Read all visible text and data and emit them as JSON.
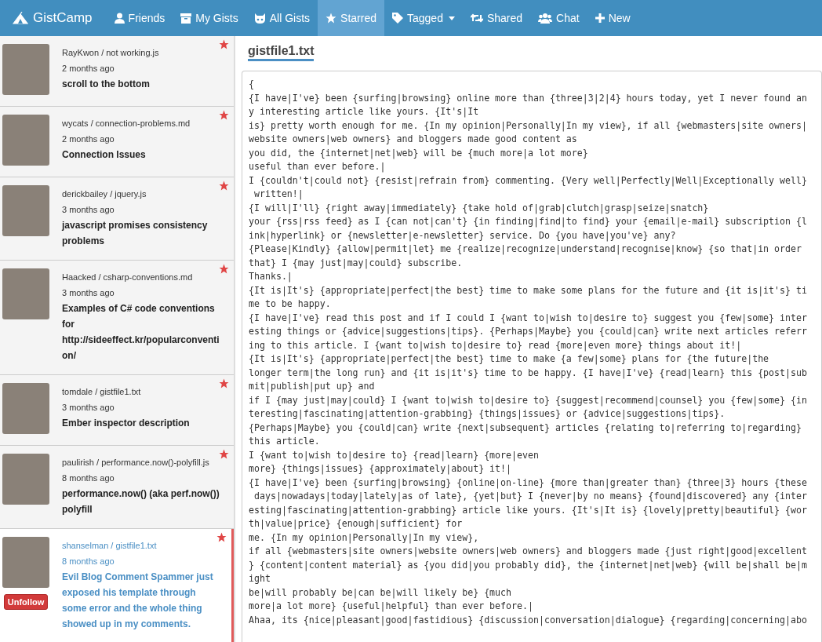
{
  "navbar": {
    "brand": "GistCamp",
    "items": [
      {
        "label": "Friends",
        "kind": "user",
        "selected": false,
        "dropdown": false
      },
      {
        "label": "My Gists",
        "kind": "box",
        "selected": false,
        "dropdown": false
      },
      {
        "label": "All Gists",
        "kind": "cat",
        "selected": false,
        "dropdown": false
      },
      {
        "label": "Starred",
        "kind": "star",
        "selected": true,
        "dropdown": false
      },
      {
        "label": "Tagged",
        "kind": "tag",
        "selected": false,
        "dropdown": true
      },
      {
        "label": "Shared",
        "kind": "retweet",
        "selected": false,
        "dropdown": false
      },
      {
        "label": "Chat",
        "kind": "group",
        "selected": false,
        "dropdown": false
      },
      {
        "label": "New",
        "kind": "plus",
        "selected": false,
        "dropdown": false
      }
    ]
  },
  "gists": [
    {
      "author": "RayKwon / not working.js",
      "time": "2 months ago",
      "title": "scroll to the bottom",
      "selected": false
    },
    {
      "author": "wycats / connection-problems.md",
      "time": "2 months ago",
      "title": "Connection Issues",
      "selected": false
    },
    {
      "author": "derickbailey / jquery.js",
      "time": "3 months ago",
      "title": "javascript promises consistency problems",
      "selected": false
    },
    {
      "author": "Haacked / csharp-conventions.md",
      "time": "3 months ago",
      "title": "Examples of C# code conventions for http://sideeffect.kr/popularconvention/",
      "selected": false
    },
    {
      "author": "tomdale / gistfile1.txt",
      "time": "3 months ago",
      "title": "Ember inspector description",
      "selected": false
    },
    {
      "author": "paulirish / performance.now()-polyfill.js",
      "time": "8 months ago",
      "title": "performance.now() (aka perf.now()) polyfill",
      "selected": false
    },
    {
      "author": "shanselman / gistfile1.txt",
      "time": "8 months ago",
      "title": "Evil Blog Comment Spammer just exposed his template through some error and the whole thing showed up in my comments.",
      "selected": true,
      "button": "Unfollow"
    }
  ],
  "file": {
    "name": "gistfile1.txt",
    "lines": [
      "{",
      "{I have|I've} been {surfing|browsing} online more than {three|3|2|4} hours today, yet I never found an",
      "y interesting article like yours. {It's|It",
      "is} pretty worth enough for me. {In my opinion|Personally|In my view}, if all {webmasters|site owners|",
      "website owners|web owners} and bloggers made good content as",
      "you did, the {internet|net|web} will be {much more|a lot more}",
      "useful than ever before.|",
      "I {couldn't|could not} {resist|refrain from} commenting. {Very well|Perfectly|Well|Exceptionally well}",
      " written!|",
      "{I will|I'll} {right away|immediately} {take hold of|grab|clutch|grasp|seize|snatch}",
      "your {rss|rss feed} as I {can not|can't} {in finding|find|to find} your {email|e-mail} subscription {l",
      "ink|hyperlink} or {newsletter|e-newsletter} service. Do {you have|you've} any?",
      "{Please|Kindly} {allow|permit|let} me {realize|recognize|understand|recognise|know} {so that|in order",
      "that} I {may just|may|could} subscribe.",
      "Thanks.|",
      "{It is|It's} {appropriate|perfect|the best} time to make some plans for the future and {it is|it's} ti",
      "me to be happy.",
      "{I have|I've} read this post and if I could I {want to|wish to|desire to} suggest you {few|some} inter",
      "esting things or {advice|suggestions|tips}. {Perhaps|Maybe} you {could|can} write next articles referr",
      "ing to this article. I {want to|wish to|desire to} read {more|even more} things about it!|",
      "{It is|It's} {appropriate|perfect|the best} time to make {a few|some} plans for {the future|the",
      "longer term|the long run} and {it is|it's} time to be happy. {I have|I've} {read|learn} this {post|sub",
      "mit|publish|put up} and",
      "if I {may just|may|could} I {want to|wish to|desire to} {suggest|recommend|counsel} you {few|some} {in",
      "teresting|fascinating|attention-grabbing} {things|issues} or {advice|suggestions|tips}.",
      "{Perhaps|Maybe} you {could|can} write {next|subsequent} articles {relating to|referring to|regarding}",
      "this article.",
      "I {want to|wish to|desire to} {read|learn} {more|even",
      "more} {things|issues} {approximately|about} it!|",
      "{I have|I've} been {surfing|browsing} {online|on-line} {more than|greater than} {three|3} hours {these",
      " days|nowadays|today|lately|as of late}, {yet|but} I {never|by no means} {found|discovered} any {inter",
      "esting|fascinating|attention-grabbing} article like yours. {It's|It is} {lovely|pretty|beautiful} {wor",
      "th|value|price} {enough|sufficient} for",
      "me. {In my opinion|Personally|In my view},",
      "if all {webmasters|site owners|website owners|web owners} and bloggers made {just right|good|excellent",
      "} {content|content material} as {you did|you probably did}, the {internet|net|web} {will be|shall be|m",
      "ight",
      "be|will probably be|can be|will likely be} {much",
      "more|a lot more} {useful|helpful} than ever before.|",
      "Ahaa, its {nice|pleasant|good|fastidious} {discussion|conversation|dialogue} {regarding|concerning|abo"
    ]
  }
}
